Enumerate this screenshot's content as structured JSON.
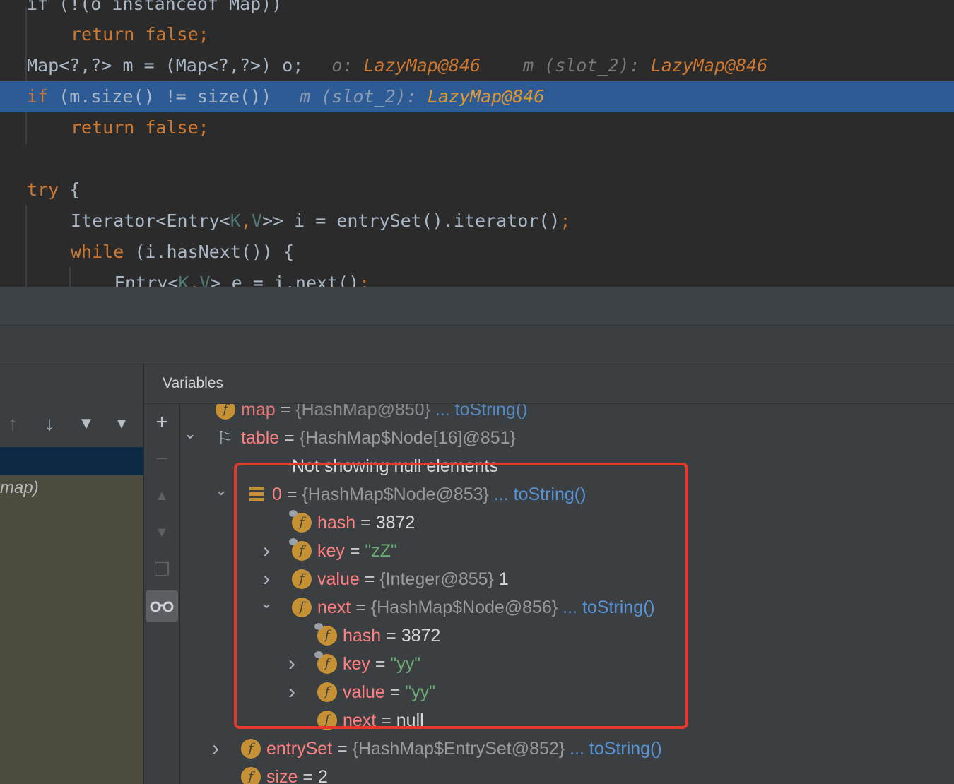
{
  "editor": {
    "lines": [
      {
        "segs": [
          {
            "t": "if (!(o instanceof Map))",
            "c": "fn"
          }
        ]
      },
      {
        "segs": [
          {
            "t": "return false;",
            "c": "kw"
          }
        ]
      },
      {
        "segs": [
          {
            "t": "Map<?,?> m = (Map<?,?>) o;",
            "c": "fn"
          }
        ],
        "hints": [
          {
            "name": "o: ",
            "val": "LazyMap@846"
          },
          {
            "name": "m (slot_2): ",
            "val": "LazyMap@846"
          }
        ]
      },
      {
        "segs": [
          {
            "t": "if",
            "c": "kw"
          },
          {
            "t": " (m.size() != size())",
            "c": "fn"
          }
        ],
        "hints": [
          {
            "name": "m (slot_2): ",
            "val": "LazyMap@846"
          }
        ]
      },
      {
        "segs": [
          {
            "t": "return false;",
            "c": "kw"
          }
        ]
      },
      {
        "segs": []
      },
      {
        "segs": [
          {
            "t": "try",
            "c": "kw"
          },
          {
            "t": " {",
            "c": "fn"
          }
        ]
      },
      {
        "segs": [
          {
            "t": "Iterator<Entry<",
            "c": "fn"
          },
          {
            "t": "K",
            "c": "tp"
          },
          {
            "t": ",",
            "c": "kw"
          },
          {
            "t": "V",
            "c": "tp"
          },
          {
            "t": ">> i = entrySet().iterator()",
            "c": "fn"
          },
          {
            "t": ";",
            "c": "kw"
          }
        ]
      },
      {
        "segs": [
          {
            "t": "while",
            "c": "kw"
          },
          {
            "t": " (i.hasNext()) {",
            "c": "fn"
          }
        ]
      },
      {
        "segs": [
          {
            "t": "Entry<",
            "c": "fn"
          },
          {
            "t": "K",
            "c": "tp"
          },
          {
            "t": ",",
            "c": "kw"
          },
          {
            "t": "V",
            "c": "tp"
          },
          {
            "t": "> e = i.next()",
            "c": "fn"
          },
          {
            "t": ";",
            "c": "kw"
          }
        ]
      }
    ]
  },
  "frames": {
    "other_frame_label": "map)"
  },
  "variables": {
    "title": "Variables",
    "rows": [
      {
        "name": "map",
        "eq": " = ",
        "type": "{HashMap@850}",
        "link": " ... toString()",
        "partial": true
      },
      {
        "name": "table",
        "eq": " = ",
        "type": "{HashMap$Node[16]@851}",
        "expanded": true,
        "icon": "flag"
      },
      {
        "info": "Not showing null elements"
      },
      {
        "name": "0",
        "eq": " = ",
        "type": "{HashMap$Node@853}",
        "link": " ... toString()",
        "expanded": true,
        "icon": "array"
      },
      {
        "name": "hash",
        "eq": " = ",
        "value": "3872",
        "vclass": "vnum",
        "icon": "field-locked"
      },
      {
        "name": "key",
        "eq": " = ",
        "value": "\"zZ\"",
        "vclass": "vstr",
        "icon": "field-locked",
        "collapsed": true
      },
      {
        "name": "value",
        "eq": " = ",
        "type": "{Integer@855}",
        "value": " 1",
        "vclass": "vnum",
        "icon": "field",
        "collapsed": true
      },
      {
        "name": "next",
        "eq": " = ",
        "type": "{HashMap$Node@856}",
        "link": " ... toString()",
        "expanded": true,
        "icon": "field"
      },
      {
        "name": "hash",
        "eq": " = ",
        "value": "3872",
        "vclass": "vnum",
        "icon": "field-locked"
      },
      {
        "name": "key",
        "eq": " = ",
        "value": "\"yy\"",
        "vclass": "vstr",
        "icon": "field-locked",
        "collapsed": true
      },
      {
        "name": "value",
        "eq": " = ",
        "value": "\"yy\"",
        "vclass": "vstr",
        "icon": "field",
        "collapsed": true
      },
      {
        "name": "next",
        "eq": " = ",
        "value": "null",
        "vclass": "vgray",
        "icon": "field"
      },
      {
        "name": "entrySet",
        "eq": " = ",
        "type": "{HashMap$EntrySet@852}",
        "link": " ... toString()",
        "icon": "field",
        "collapsed": true
      },
      {
        "name": "size",
        "eq": " = ",
        "value": "2",
        "vclass": "vnum",
        "icon": "field"
      }
    ]
  },
  "icons": {
    "field_letter": "f",
    "up_arrow": "↑",
    "down_arrow": "↓",
    "filter": "▼",
    "dropdown": "▾",
    "plus": "+",
    "minus": "−",
    "move_up": "▲",
    "move_down": "▼",
    "copy": "❐",
    "watches": "👓",
    "expanded": "⌄",
    "collapsed": "›",
    "flag": "⚐",
    "array": "≡"
  },
  "colors": {
    "highlight_box": "#e53a2b",
    "selected_line": "#2d5b96",
    "keyword": "#cc7832",
    "field_name": "#ff8080",
    "string_value": "#6aab73",
    "link": "#5894d6"
  }
}
